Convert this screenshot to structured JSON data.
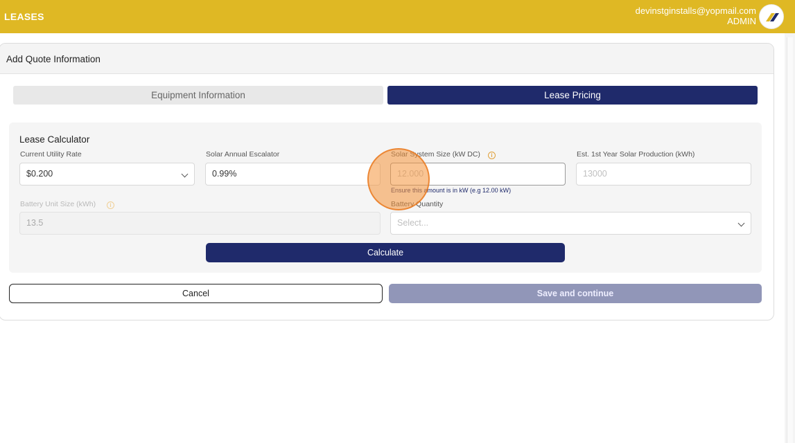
{
  "header": {
    "title": "LEASES",
    "user_email": "devinstginstalls@yopmail.com",
    "user_role": "ADMIN",
    "logo_icon": "brand-logo-icon",
    "color": "#dfb824"
  },
  "card": {
    "title": "Add Quote Information"
  },
  "tabs": [
    {
      "label": "Equipment Information",
      "active": false
    },
    {
      "label": "Lease Pricing",
      "active": true
    }
  ],
  "calculator": {
    "title": "Lease Calculator",
    "utility_rate": {
      "label": "Current Utility Rate",
      "value": "$0.200"
    },
    "escalator": {
      "label": "Solar Annual Escalator",
      "value": "0.99%"
    },
    "system_size": {
      "label": "Solar System Size (kW DC)",
      "placeholder": "12.000",
      "hint": "Ensure this amount is in kW (e.g 12.00 kW)"
    },
    "production": {
      "label": "Est. 1st Year Solar Production (kWh)",
      "placeholder": "13000"
    },
    "battery_size": {
      "label": "Battery Unit Size (kWh)",
      "value": "13.5"
    },
    "battery_qty": {
      "label": "Battery Quantity",
      "placeholder": "Select..."
    },
    "calculate_label": "Calculate"
  },
  "actions": {
    "cancel_label": "Cancel",
    "save_label": "Save and continue"
  },
  "colors": {
    "primary": "#1f2a6b",
    "disabled_button": "#9196b8",
    "warning_icon": "#e0a13b"
  }
}
